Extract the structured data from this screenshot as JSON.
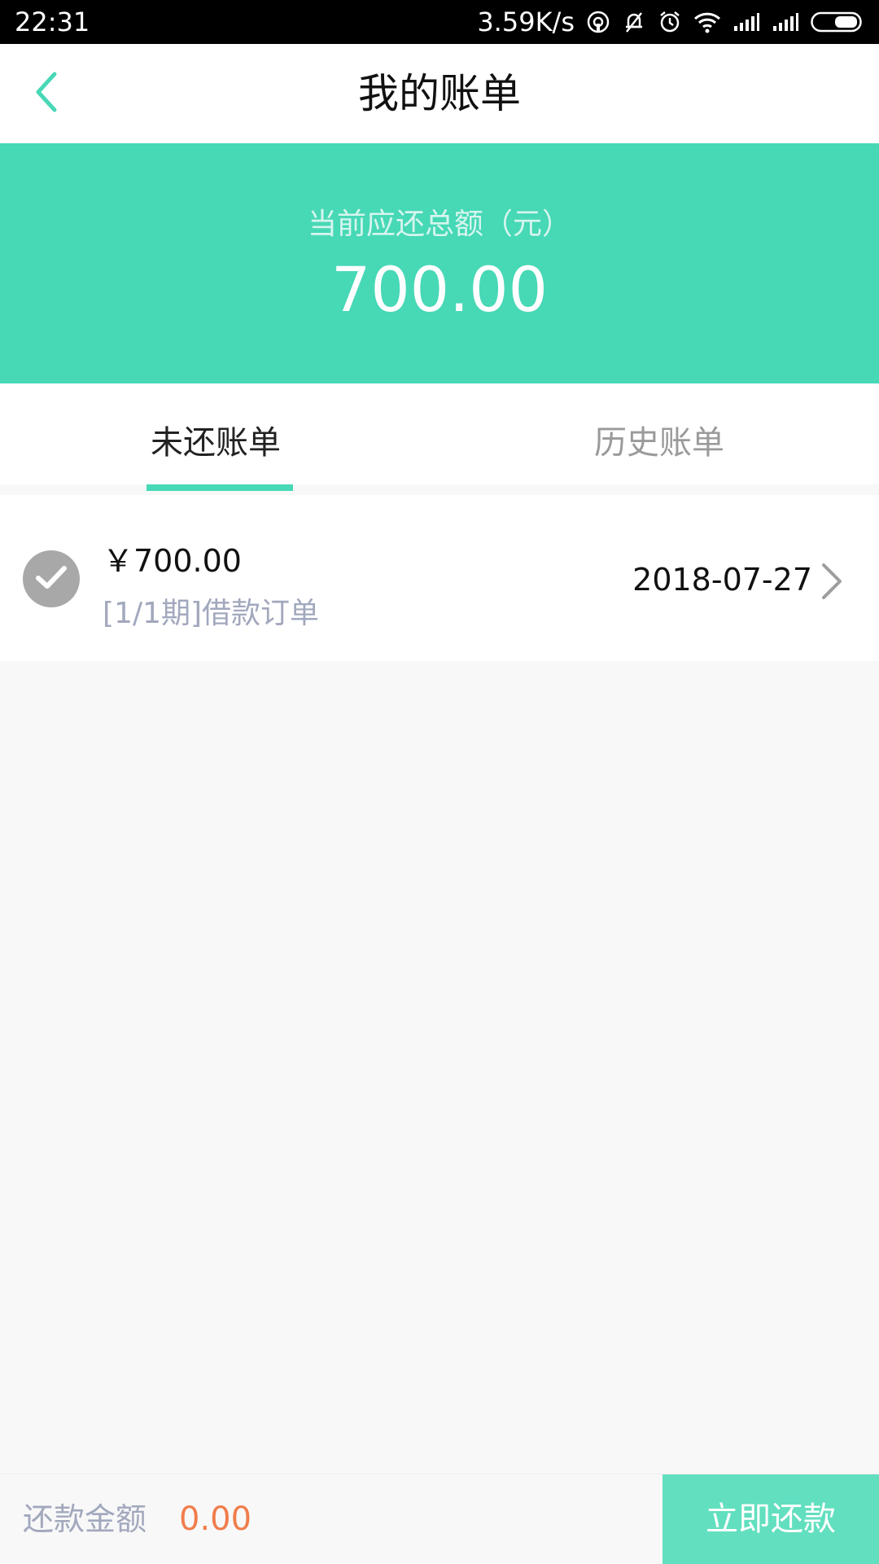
{
  "status_bar": {
    "time": "22:31",
    "speed": "3.59K/s",
    "icons": [
      "hotspot-icon",
      "bell-off-icon",
      "alarm-icon",
      "wifi-icon",
      "signal-icon",
      "signal-icon",
      "battery-icon"
    ]
  },
  "nav": {
    "back_icon": "chevron-left-icon",
    "title": "我的账单"
  },
  "summary": {
    "label": "当前应还总额（元）",
    "amount": "700.00"
  },
  "tabs": [
    {
      "label": "未还账单",
      "active": true
    },
    {
      "label": "历史账单",
      "active": false
    }
  ],
  "bills": [
    {
      "amount": "￥700.00",
      "description": "[1/1期]借款订单",
      "date": "2018-07-27",
      "selected": true
    }
  ],
  "footer": {
    "pay_label": "还款金额",
    "pay_amount": "0.00",
    "pay_button": "立即还款"
  },
  "colors": {
    "accent": "#47d8b6",
    "button": "#62dfbf",
    "amount_orange": "#f07d4c",
    "muted": "#a2a8bd"
  }
}
